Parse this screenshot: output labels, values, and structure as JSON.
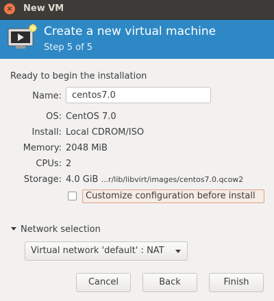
{
  "window": {
    "title": "New VM",
    "close_glyph": "×"
  },
  "header": {
    "title": "Create a new virtual machine",
    "step": "Step 5 of 5",
    "icon": "monitor-play-icon",
    "accent_color": "#2e88c5"
  },
  "summary": {
    "heading": "Ready to begin the installation",
    "name_label": "Name:",
    "name_value": "centos7.0",
    "os_label": "OS:",
    "os_value": "CentOS 7.0",
    "install_label": "Install:",
    "install_value": "Local CDROM/ISO",
    "memory_label": "Memory:",
    "memory_value": "2048 MiB",
    "cpus_label": "CPUs:",
    "cpus_value": "2",
    "storage_label": "Storage:",
    "storage_size": "4.0 GiB",
    "storage_path": "...r/lib/libvirt/images/centos7.0.qcow2"
  },
  "customize": {
    "label": "Customize configuration before install",
    "checked": false
  },
  "network": {
    "expander_label": "Network selection",
    "selected": "Virtual network 'default' : NAT"
  },
  "buttons": {
    "cancel": "Cancel",
    "back": "Back",
    "finish": "Finish"
  }
}
